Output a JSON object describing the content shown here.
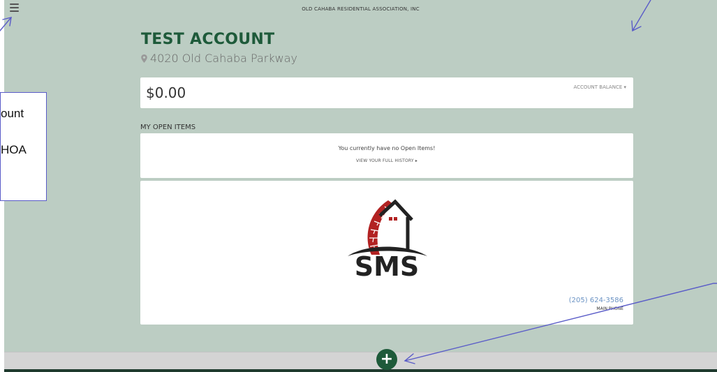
{
  "header": {
    "org_name": "OLD CAHABA RESIDENTIAL ASSOCIATION, INC",
    "menu_icon": "hamburger-menu-icon"
  },
  "account": {
    "name": "TEST ACCOUNT",
    "address": "4020 Old Cahaba Parkway",
    "address_icon": "map-pin-icon"
  },
  "balance": {
    "amount": "$0.00",
    "label": "ACCOUNT BALANCE ▾"
  },
  "open_items": {
    "section_title": "MY OPEN ITEMS",
    "empty_message": "You currently have no Open Items!",
    "history_link": "VIEW YOUR FULL HISTORY ▸"
  },
  "company": {
    "logo_text": "SMS",
    "phone": "(205) 624-3586",
    "phone_label": "MAIN PHONE"
  },
  "footer": {
    "add_label": "+"
  },
  "annotation": {
    "lines": [
      "ount",
      "HOA"
    ]
  },
  "colors": {
    "page_bg": "#bccdc3",
    "brand_green": "#1e5a3a",
    "link_blue": "#6b93c4",
    "arrow_blue": "#5a5cc8",
    "brick_red": "#b22222"
  }
}
